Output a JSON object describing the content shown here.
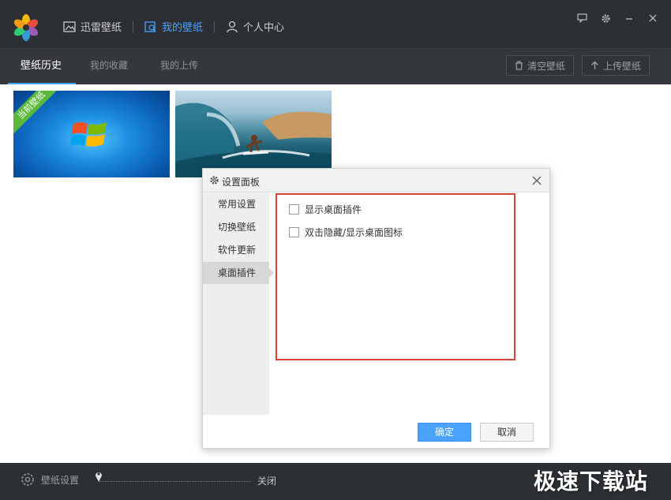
{
  "header": {
    "nav": [
      {
        "label": "迅雷壁纸",
        "icon": "image-icon",
        "active": false
      },
      {
        "label": "我的壁纸",
        "icon": "my-wallpaper-icon",
        "active": true
      },
      {
        "label": "个人中心",
        "icon": "user-icon",
        "active": false
      }
    ],
    "window_controls": [
      "feedback-icon",
      "gear-icon",
      "minimize-icon",
      "close-icon"
    ]
  },
  "subtabs": [
    {
      "label": "壁纸历史",
      "active": true
    },
    {
      "label": "我的收藏",
      "active": false
    },
    {
      "label": "我的上传",
      "active": false
    }
  ],
  "toolbar": {
    "clear_label": "清空壁纸",
    "upload_label": "上传壁纸"
  },
  "wallpapers": [
    {
      "ribbon": "当前壁纸",
      "current": true
    },
    {
      "ribbon": "",
      "current": false
    }
  ],
  "dialog": {
    "title": "设置面板",
    "side_items": [
      {
        "label": "常用设置",
        "active": false
      },
      {
        "label": "切换壁纸",
        "active": false
      },
      {
        "label": "软件更新",
        "active": false
      },
      {
        "label": "桌面插件",
        "active": true
      }
    ],
    "options": [
      {
        "label": "显示桌面插件",
        "checked": false
      },
      {
        "label": "双击隐藏/显示桌面图标",
        "checked": false
      }
    ],
    "ok_label": "确定",
    "cancel_label": "取消"
  },
  "bottom": {
    "settings_label": "壁纸设置",
    "slider_label": "关闭"
  },
  "watermark": "极速下载站",
  "colors": {
    "accent": "#4aa3ff",
    "dark_bg": "#2c2f33",
    "highlight": "#d9413b",
    "ribbon": "#5bb83a"
  }
}
